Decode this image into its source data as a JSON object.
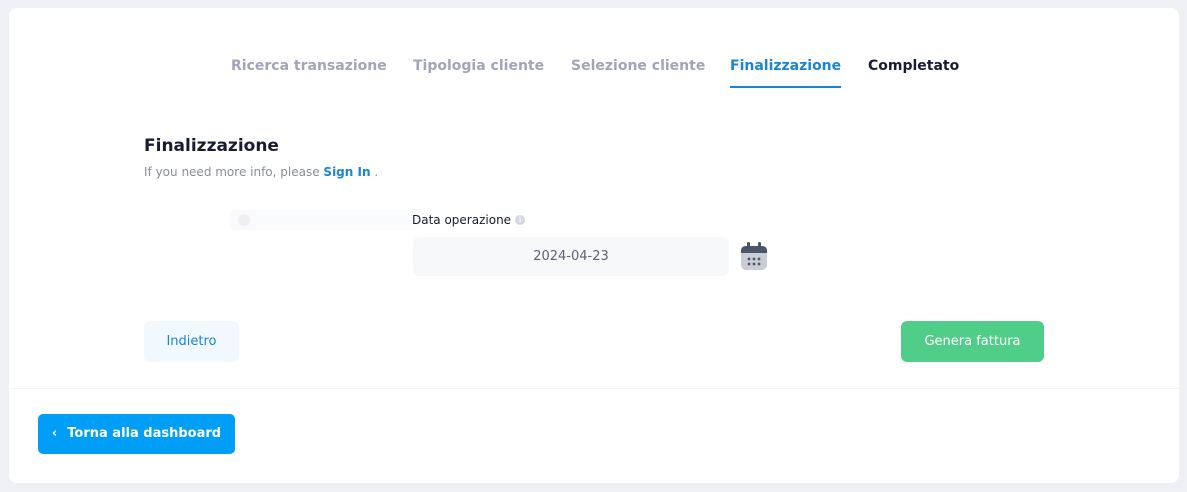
{
  "stepper": {
    "steps": [
      {
        "label": "Ricerca transazione",
        "state": "done"
      },
      {
        "label": "Tipologia cliente",
        "state": "done"
      },
      {
        "label": "Selezione cliente",
        "state": "done"
      },
      {
        "label": "Finalizzazione",
        "state": "active"
      },
      {
        "label": "Completato",
        "state": "next"
      }
    ]
  },
  "form": {
    "title": "Finalizzazione",
    "subtitle_prefix": "If you need more info, please ",
    "subtitle_link": "Sign In",
    "subtitle_suffix": " .",
    "date_label": "Data operazione",
    "date_value": "2024-04-23",
    "info_icon": "i"
  },
  "actions": {
    "back_label": "Indietro",
    "generate_label": "Genera fattura"
  },
  "footer": {
    "chevron": "‹",
    "dashboard_label": "Torna alla dashboard"
  },
  "colors": {
    "accent": "#1b84d6",
    "success": "#50cd89",
    "primary_button": "#009ef7"
  }
}
